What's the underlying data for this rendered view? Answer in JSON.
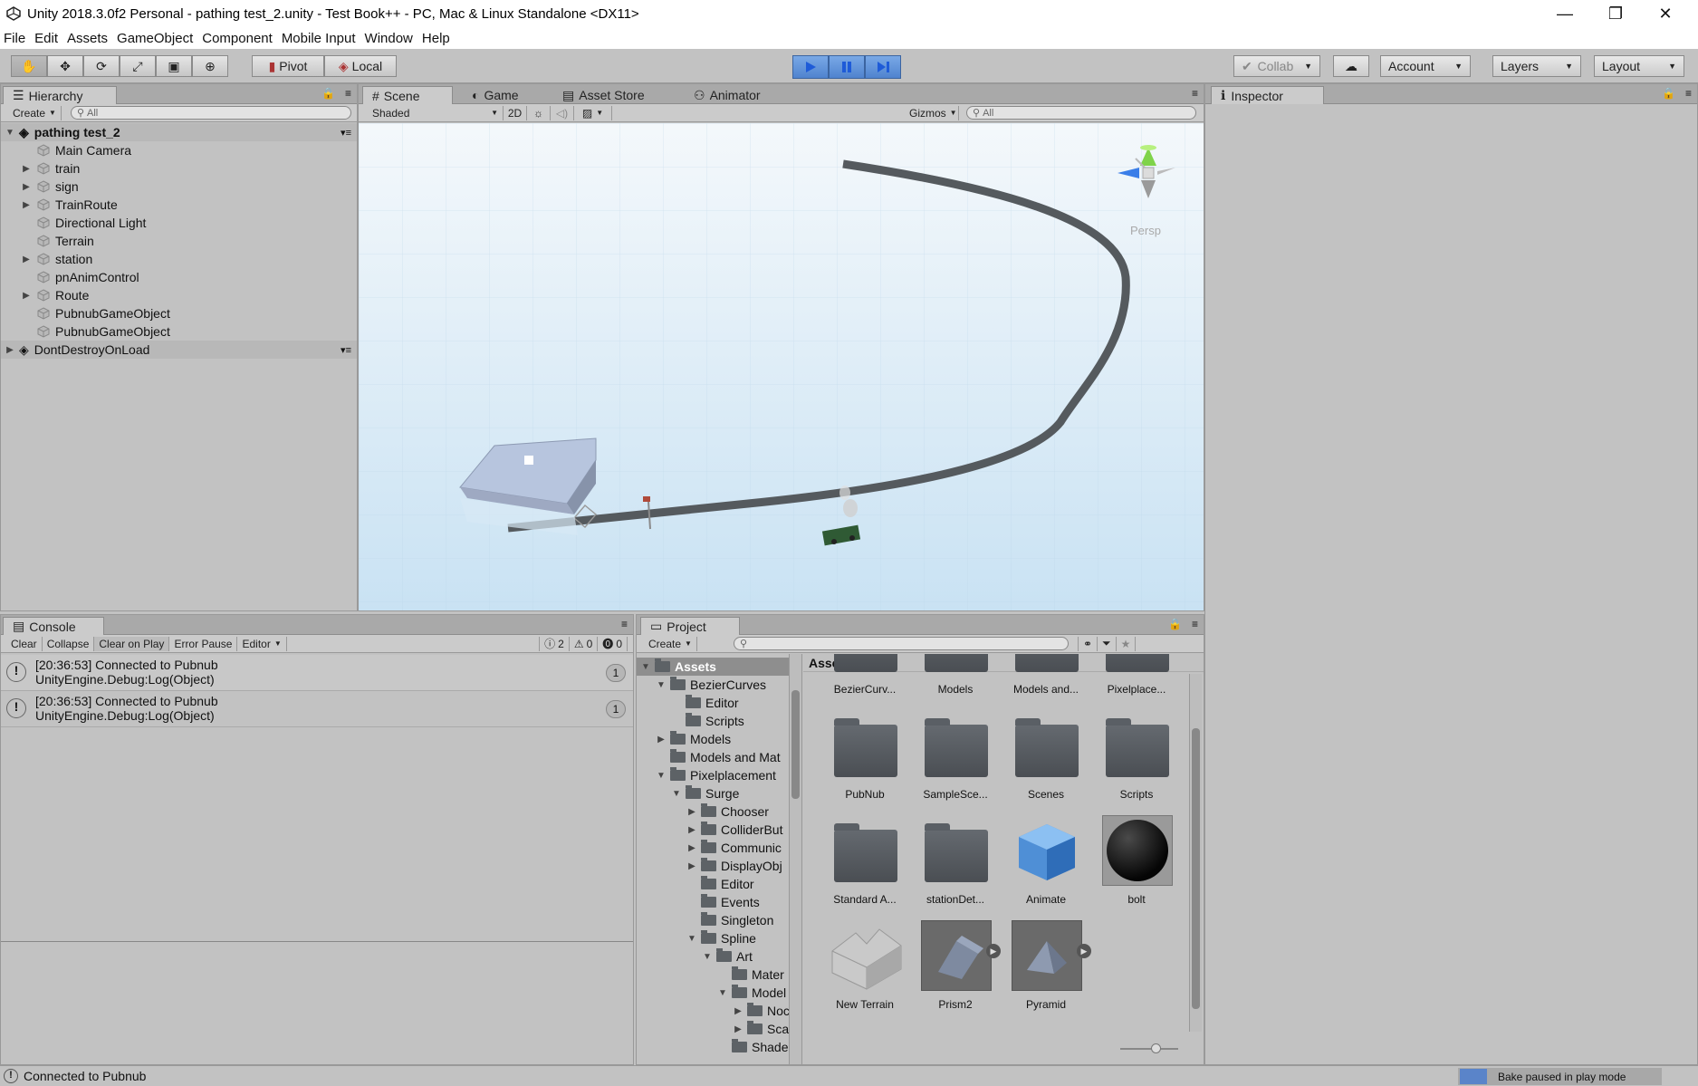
{
  "window": {
    "title": "Unity 2018.3.0f2 Personal - pathing test_2.unity - Test Book++ - PC, Mac & Linux Standalone <DX11>"
  },
  "menu": [
    "File",
    "Edit",
    "Assets",
    "GameObject",
    "Component",
    "Mobile Input",
    "Window",
    "Help"
  ],
  "toolbar": {
    "pivot": "Pivot",
    "local": "Local",
    "collab": "Collab",
    "account": "Account",
    "layers": "Layers",
    "layout": "Layout"
  },
  "hierarchy": {
    "tab": "Hierarchy",
    "create": "Create",
    "search_placeholder": "All",
    "scene": "pathing test_2",
    "items": [
      {
        "label": "Main Camera",
        "expandable": false
      },
      {
        "label": "train",
        "expandable": true
      },
      {
        "label": "sign",
        "expandable": true
      },
      {
        "label": "TrainRoute",
        "expandable": true
      },
      {
        "label": "Directional Light",
        "expandable": false
      },
      {
        "label": "Terrain",
        "expandable": false
      },
      {
        "label": "station",
        "expandable": true
      },
      {
        "label": "pnAnimControl",
        "expandable": false
      },
      {
        "label": "Route",
        "expandable": true
      },
      {
        "label": "PubnubGameObject",
        "expandable": false
      },
      {
        "label": "PubnubGameObject",
        "expandable": false
      }
    ],
    "dontdestroy": "DontDestroyOnLoad"
  },
  "scene": {
    "tabs": [
      "Scene",
      "Game",
      "Asset Store",
      "Animator"
    ],
    "shading": "Shaded",
    "mode2d": "2D",
    "gizmos": "Gizmos",
    "search_placeholder": "All",
    "persp": "Persp"
  },
  "inspector": {
    "tab": "Inspector"
  },
  "console": {
    "tab": "Console",
    "buttons": [
      "Clear",
      "Collapse",
      "Clear on Play",
      "Error Pause",
      "Editor"
    ],
    "counts": {
      "log": "2",
      "warn": "0",
      "error": "0"
    },
    "entries": [
      {
        "line1": "[20:36:53] Connected to Pubnub",
        "line2": "UnityEngine.Debug:Log(Object)",
        "count": "1"
      },
      {
        "line1": "[20:36:53] Connected to Pubnub",
        "line2": "UnityEngine.Debug:Log(Object)",
        "count": "1"
      }
    ]
  },
  "project": {
    "tab": "Project",
    "create": "Create",
    "breadcrumb": "Assets",
    "tree": [
      {
        "label": "Assets",
        "depth": 0,
        "arrow": "▼",
        "selected": true
      },
      {
        "label": "BezierCurves",
        "depth": 1,
        "arrow": "▼"
      },
      {
        "label": "Editor",
        "depth": 2,
        "arrow": ""
      },
      {
        "label": "Scripts",
        "depth": 2,
        "arrow": ""
      },
      {
        "label": "Models",
        "depth": 1,
        "arrow": "▶"
      },
      {
        "label": "Models and Mat",
        "depth": 1,
        "arrow": ""
      },
      {
        "label": "Pixelplacement",
        "depth": 1,
        "arrow": "▼"
      },
      {
        "label": "Surge",
        "depth": 2,
        "arrow": "▼"
      },
      {
        "label": "Chooser",
        "depth": 3,
        "arrow": "▶"
      },
      {
        "label": "ColliderBut",
        "depth": 3,
        "arrow": "▶"
      },
      {
        "label": "Communic",
        "depth": 3,
        "arrow": "▶"
      },
      {
        "label": "DisplayObj",
        "depth": 3,
        "arrow": "▶"
      },
      {
        "label": "Editor",
        "depth": 3,
        "arrow": ""
      },
      {
        "label": "Events",
        "depth": 3,
        "arrow": ""
      },
      {
        "label": "Singleton",
        "depth": 3,
        "arrow": ""
      },
      {
        "label": "Spline",
        "depth": 3,
        "arrow": "▼"
      },
      {
        "label": "Art",
        "depth": 4,
        "arrow": "▼"
      },
      {
        "label": "Mater",
        "depth": 5,
        "arrow": ""
      },
      {
        "label": "Model",
        "depth": 5,
        "arrow": "▼"
      },
      {
        "label": "Noc",
        "depth": 6,
        "arrow": "▶"
      },
      {
        "label": "Sca",
        "depth": 6,
        "arrow": "▶"
      },
      {
        "label": "Shade",
        "depth": 5,
        "arrow": ""
      }
    ],
    "assets": [
      {
        "label": "BezierCurv...",
        "kind": "folder"
      },
      {
        "label": "Models",
        "kind": "folder"
      },
      {
        "label": "Models and...",
        "kind": "folder"
      },
      {
        "label": "Pixelplace...",
        "kind": "folder"
      },
      {
        "label": "PubNub",
        "kind": "folder"
      },
      {
        "label": "SampleSce...",
        "kind": "folder"
      },
      {
        "label": "Scenes",
        "kind": "folder"
      },
      {
        "label": "Scripts",
        "kind": "folder"
      },
      {
        "label": "Standard A...",
        "kind": "folder"
      },
      {
        "label": "stationDet...",
        "kind": "folder"
      },
      {
        "label": "Animate",
        "kind": "cube"
      },
      {
        "label": "bolt",
        "kind": "sphere"
      },
      {
        "label": "New Terrain",
        "kind": "terrain"
      },
      {
        "label": "Prism2",
        "kind": "prism"
      },
      {
        "label": "Pyramid",
        "kind": "pyramid"
      }
    ]
  },
  "status": {
    "message": "Connected to Pubnub",
    "bake": "Bake paused in play mode"
  }
}
